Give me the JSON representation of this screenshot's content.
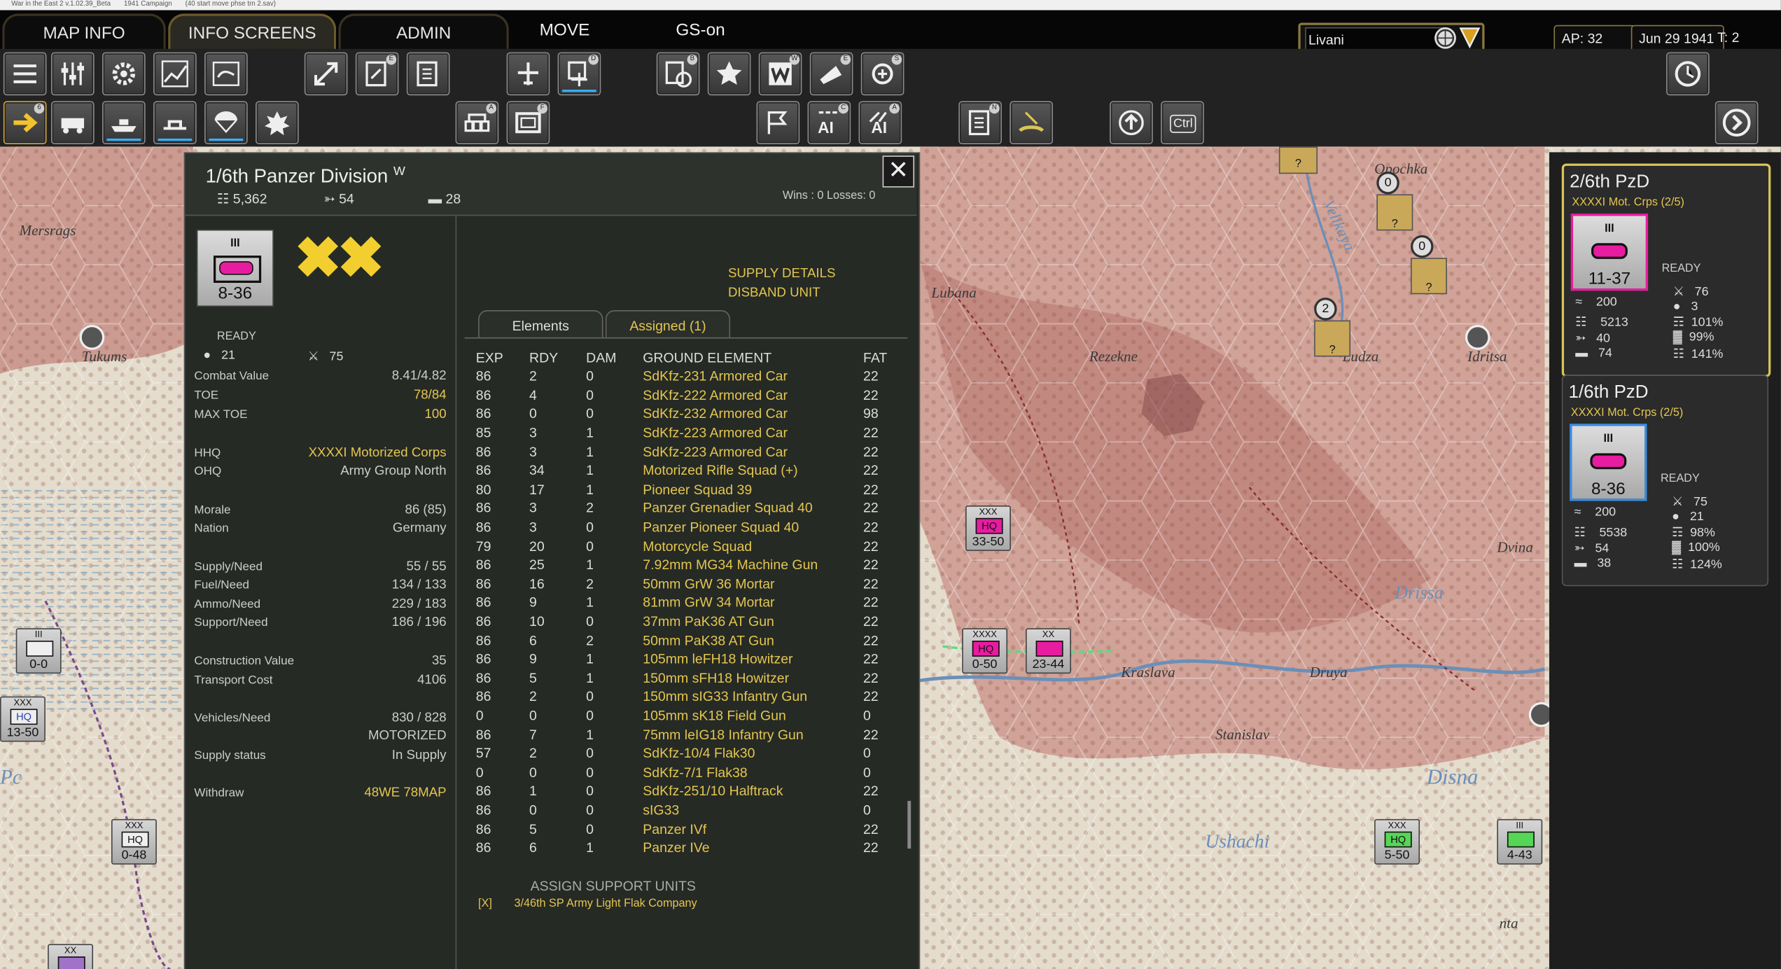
{
  "window_title": [
    "War in the East 2 v.1.02.39_Beta",
    "1941 Campaign",
    "(40 start move phse trn 2.sav)"
  ],
  "menu": {
    "tabs": [
      "MAP INFO",
      "INFO SCREENS",
      "ADMIN"
    ],
    "move": "MOVE",
    "gs": "GS-on"
  },
  "search": {
    "value": "Livani"
  },
  "status": {
    "ap": "AP: 32",
    "date": "Jun 29 1941",
    "turn": "T: 2"
  },
  "map_labels": [
    "Mersrags",
    "Tukums",
    "Lubana",
    "Rezekne",
    "Ludza",
    "Idritsa",
    "Velikaya",
    "Opochka",
    "Kraslava",
    "Drissa",
    "Druya",
    "Stanislav",
    "Dvina",
    "Disna",
    "Ushachi",
    "nta",
    "Pc"
  ],
  "map_counters": [
    {
      "size": "XXX",
      "label": "HQ",
      "strength": "33-50"
    },
    {
      "size": "XXXX",
      "label": "HQ",
      "strength": "0-50"
    },
    {
      "size": "XX",
      "label": "",
      "strength": "23-44"
    },
    {
      "size": "XXX",
      "label": "HQ",
      "strength": "5-50"
    },
    {
      "size": "III",
      "label": "",
      "strength": "4-43"
    },
    {
      "size": "III",
      "label": "",
      "strength": "0-0"
    },
    {
      "size": "XXX",
      "label": "HQ",
      "strength": "13-50"
    },
    {
      "size": "XXX",
      "label": "HQ",
      "strength": "0-48"
    },
    {
      "size": "XX",
      "label": "",
      "strength": ""
    }
  ],
  "map_markers": [
    {
      "top": "0",
      "bottom": "?"
    },
    {
      "top": "0",
      "bottom": "?"
    },
    {
      "top": "2",
      "bottom": "?"
    },
    {
      "top": "",
      "bottom": "?"
    }
  ],
  "panel": {
    "title": "1/6th Panzer Division",
    "superscript": "W",
    "men": "5,362",
    "guns": "54",
    "tanks": "28",
    "wins_losses": "Wins : 0  Losses: 0",
    "counter": {
      "size": "III",
      "strength": "8-36"
    },
    "ready": "READY",
    "ready_a": "21",
    "ready_b": "75",
    "stats": [
      {
        "label": "Combat Value",
        "value": "8.41/4.82",
        "color": "white"
      },
      {
        "label": "TOE",
        "value": "78/84",
        "color": "yellow"
      },
      {
        "label": "MAX TOE",
        "value": "100",
        "color": "yellow"
      },
      {
        "label": "HHQ",
        "value": "XXXXI Motorized Corps",
        "color": "yellow"
      },
      {
        "label": "OHQ",
        "value": "Army Group North",
        "color": "white"
      },
      {
        "label": "Morale",
        "value": "86 (85)",
        "color": "white"
      },
      {
        "label": "Nation",
        "value": "Germany",
        "color": "white"
      },
      {
        "label": "Supply/Need",
        "value": "55 / 55",
        "color": "white"
      },
      {
        "label": "Fuel/Need",
        "value": "134 / 133",
        "color": "white"
      },
      {
        "label": "Ammo/Need",
        "value": "229 / 183",
        "color": "white"
      },
      {
        "label": "Support/Need",
        "value": "186 / 196",
        "color": "white"
      },
      {
        "label": "Construction Value",
        "value": "35",
        "color": "white"
      },
      {
        "label": "Transport Cost",
        "value": "4106",
        "color": "white"
      },
      {
        "label": "Vehicles/Need",
        "value": "830 / 828",
        "color": "white"
      },
      {
        "label": "",
        "value": "MOTORIZED",
        "color": "white"
      },
      {
        "label": "Supply status",
        "value": "In Supply",
        "color": "white"
      },
      {
        "label": "Withdraw",
        "value": "48WE  78MAP",
        "color": "yellow"
      }
    ],
    "links": [
      "SUPPLY DETAILS",
      "DISBAND UNIT"
    ],
    "tabs": [
      "Elements",
      "Assigned (1)"
    ],
    "columns": [
      "EXP",
      "RDY",
      "DAM",
      "GROUND ELEMENT",
      "FAT"
    ],
    "elements": [
      [
        "86",
        "2",
        "0",
        "SdKfz-231 Armored Car",
        "22"
      ],
      [
        "86",
        "4",
        "0",
        "SdKfz-222 Armored Car",
        "22"
      ],
      [
        "86",
        "0",
        "0",
        "SdKfz-232 Armored Car",
        "98"
      ],
      [
        "85",
        "3",
        "1",
        "SdKfz-223 Armored Car",
        "22"
      ],
      [
        "86",
        "3",
        "1",
        "SdKfz-223 Armored Car",
        "22"
      ],
      [
        "86",
        "34",
        "1",
        "Motorized Rifle Squad (+)",
        "22"
      ],
      [
        "80",
        "17",
        "1",
        "Pioneer Squad 39",
        "22"
      ],
      [
        "86",
        "3",
        "2",
        "Panzer Grenadier Squad 40",
        "22"
      ],
      [
        "86",
        "3",
        "0",
        "Panzer Pioneer Squad 40",
        "22"
      ],
      [
        "79",
        "20",
        "0",
        "Motorcycle Squad",
        "22"
      ],
      [
        "86",
        "25",
        "1",
        "7.92mm MG34 Machine Gun",
        "22"
      ],
      [
        "86",
        "16",
        "2",
        "50mm GrW 36 Mortar",
        "22"
      ],
      [
        "86",
        "9",
        "1",
        "81mm GrW 34 Mortar",
        "22"
      ],
      [
        "86",
        "10",
        "0",
        "37mm PaK36 AT Gun",
        "22"
      ],
      [
        "86",
        "6",
        "2",
        "50mm PaK38 AT Gun",
        "22"
      ],
      [
        "86",
        "9",
        "1",
        "105mm leFH18 Howitzer",
        "22"
      ],
      [
        "86",
        "5",
        "1",
        "150mm sFH18 Howitzer",
        "22"
      ],
      [
        "86",
        "2",
        "0",
        "150mm sIG33 Infantry Gun",
        "22"
      ],
      [
        "0",
        "0",
        "0",
        "105mm sK18 Field Gun",
        "0"
      ],
      [
        "86",
        "7",
        "1",
        "75mm leIG18 Infantry Gun",
        "22"
      ],
      [
        "57",
        "2",
        "0",
        "SdKfz-10/4 Flak30",
        "0"
      ],
      [
        "0",
        "0",
        "0",
        "SdKfz-7/1 Flak38",
        "0"
      ],
      [
        "86",
        "1",
        "0",
        "SdKfz-251/10 Halftrack",
        "22"
      ],
      [
        "86",
        "0",
        "0",
        "sIG33",
        "0"
      ],
      [
        "86",
        "5",
        "0",
        "Panzer IVf",
        "22"
      ],
      [
        "86",
        "6",
        "1",
        "Panzer IVe",
        "22"
      ]
    ],
    "assign_label": "ASSIGN SUPPORT UNITS",
    "assigned_mark": "[X]",
    "assigned_unit": "3/46th SP Army Light Flak Company"
  },
  "cards": [
    {
      "name": "2/6th PzD",
      "corps": "XXXXI Mot. Crps (2/5)",
      "size": "III",
      "strength": "11-37",
      "ready": "READY",
      "s1": "200",
      "s2": "76",
      "s3": "3",
      "s4": "5213",
      "s5": "101%",
      "s6": "40",
      "s7": "99%",
      "s8": "74",
      "s9": "141%"
    },
    {
      "name": "1/6th PzD",
      "corps": "XXXXI Mot. Crps (2/5)",
      "size": "III",
      "strength": "8-36",
      "ready": "READY",
      "s1": "200",
      "s2": "75",
      "s3": "21",
      "s4": "5538",
      "s5": "98%",
      "s6": "54",
      "s7": "100%",
      "s8": "38",
      "s9": "124%"
    }
  ],
  "toolbar_keys": {
    "a": "6",
    "b": "E",
    "c": "D",
    "d": "B",
    "e": "W",
    "f": "S",
    "g": "A",
    "h": "C",
    "i": "N",
    "j": "F"
  },
  "toolbar_labels": {
    "ai1": "AI",
    "ai2": "AI",
    "ctrl": "Ctrl"
  },
  "colors": {
    "accent": "#e3c650",
    "magenta": "#e81ca0",
    "panel": "#262a25"
  }
}
